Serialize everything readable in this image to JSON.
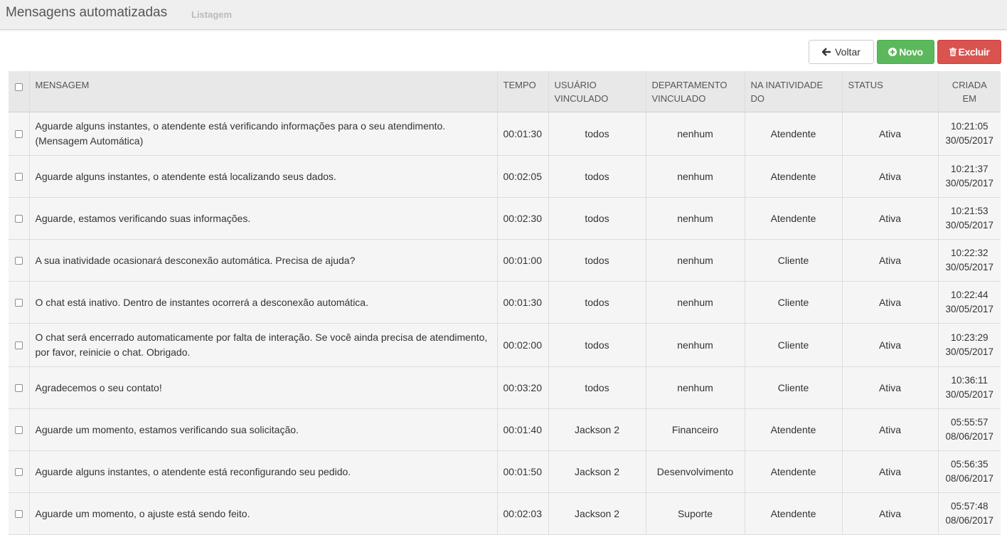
{
  "header": {
    "title": "Mensagens automatizadas",
    "subtitle": "Listagem"
  },
  "toolbar": {
    "back_label": "Voltar",
    "new_label": "Novo",
    "delete_label": "Excluir"
  },
  "colors": {
    "topbar": "#efefef",
    "success": "#5cb85c",
    "danger": "#d9534f",
    "header_bg": "#e8e8e8",
    "row_bg": "#f5f5f5"
  },
  "icons": {
    "back": "arrow-left-icon",
    "new": "plus-circle-icon",
    "delete": "trash-icon"
  },
  "table": {
    "columns": [
      {
        "line1": "MENSAGEM",
        "line2": ""
      },
      {
        "line1": "TEMPO",
        "line2": ""
      },
      {
        "line1": "USUÁRIO",
        "line2": "VINCULADO"
      },
      {
        "line1": "DEPARTAMENTO",
        "line2": "VINCULADO"
      },
      {
        "line1": "NA INATIVIDADE",
        "line2": "DO"
      },
      {
        "line1": "STATUS",
        "line2": ""
      },
      {
        "line1": "CRIADA",
        "line2": "EM"
      }
    ],
    "rows": [
      {
        "message": "Aguarde alguns instantes, o atendente está verificando informações para o seu atendimento. (Mensagem Automática)",
        "time": "00:01:30",
        "user": "todos",
        "department": "nenhum",
        "inactivity": "Atendente",
        "status": "Ativa",
        "created_time": "10:21:05",
        "created_date": "30/05/2017"
      },
      {
        "message": "Aguarde alguns instantes, o atendente está localizando seus dados.",
        "time": "00:02:05",
        "user": "todos",
        "department": "nenhum",
        "inactivity": "Atendente",
        "status": "Ativa",
        "created_time": "10:21:37",
        "created_date": "30/05/2017"
      },
      {
        "message": "Aguarde, estamos verificando suas informações.",
        "time": "00:02:30",
        "user": "todos",
        "department": "nenhum",
        "inactivity": "Atendente",
        "status": "Ativa",
        "created_time": "10:21:53",
        "created_date": "30/05/2017"
      },
      {
        "message": "A sua inatividade ocasionará desconexão automática. Precisa de ajuda?",
        "time": "00:01:00",
        "user": "todos",
        "department": "nenhum",
        "inactivity": "Cliente",
        "status": "Ativa",
        "created_time": "10:22:32",
        "created_date": "30/05/2017"
      },
      {
        "message": "O chat está inativo. Dentro de instantes ocorrerá a desconexão automática.",
        "time": "00:01:30",
        "user": "todos",
        "department": "nenhum",
        "inactivity": "Cliente",
        "status": "Ativa",
        "created_time": "10:22:44",
        "created_date": "30/05/2017"
      },
      {
        "message": "O chat será encerrado automaticamente por falta de interação. Se você ainda precisa de atendimento, por favor, reinicie o chat. Obrigado.",
        "time": "00:02:00",
        "user": "todos",
        "department": "nenhum",
        "inactivity": "Cliente",
        "status": "Ativa",
        "created_time": "10:23:29",
        "created_date": "30/05/2017"
      },
      {
        "message": "Agradecemos o seu contato!",
        "time": "00:03:20",
        "user": "todos",
        "department": "nenhum",
        "inactivity": "Cliente",
        "status": "Ativa",
        "created_time": "10:36:11",
        "created_date": "30/05/2017"
      },
      {
        "message": "Aguarde um momento, estamos verificando sua solicitação.",
        "time": "00:01:40",
        "user": "Jackson 2",
        "department": "Financeiro",
        "inactivity": "Atendente",
        "status": "Ativa",
        "created_time": "05:55:57",
        "created_date": "08/06/2017"
      },
      {
        "message": "Aguarde alguns instantes, o atendente está reconfigurando seu pedido.",
        "time": "00:01:50",
        "user": "Jackson 2",
        "department": "Desenvolvimento",
        "inactivity": "Atendente",
        "status": "Ativa",
        "created_time": "05:56:35",
        "created_date": "08/06/2017"
      },
      {
        "message": "Aguarde um momento, o ajuste está sendo feito.",
        "time": "00:02:03",
        "user": "Jackson 2",
        "department": "Suporte",
        "inactivity": "Atendente",
        "status": "Ativa",
        "created_time": "05:57:48",
        "created_date": "08/06/2017"
      }
    ]
  }
}
